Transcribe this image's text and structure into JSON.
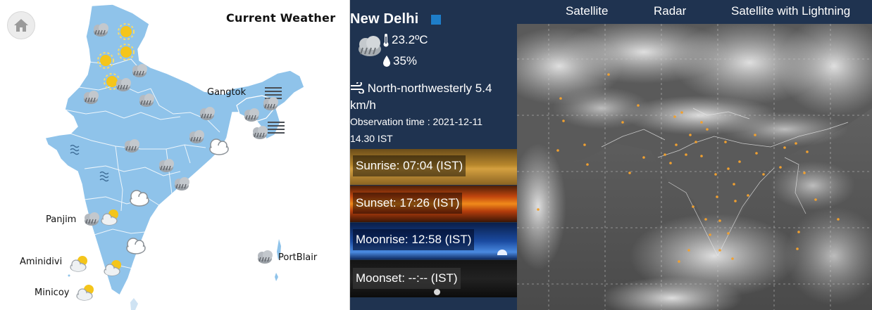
{
  "map": {
    "title": "Current Weather",
    "home_icon": "home-icon",
    "land_color": "#8fc3ea",
    "cities": {
      "gangtok": "Gangtok",
      "panjim": "Panjim",
      "aminidivi": "Aminidivi",
      "minicoy": "Minicoy",
      "portblair": "PortBlair"
    }
  },
  "city": {
    "name": "New Delhi",
    "condition_icon": "cloudy-icon",
    "temperature": "23.2ºC",
    "humidity": "35%",
    "wind": "North-northwesterly 5.4 km/h",
    "observation_line1": "Observation time : 2021-12-11",
    "observation_line2": "14.30 IST",
    "sunrise": "Sunrise: 07:04 (IST)",
    "sunset": "Sunset: 17:26 (IST)",
    "moonrise": "Moonrise: 12:58 (IST)",
    "moonset": "Moonset: --:-- (IST)"
  },
  "satellite": {
    "tabs": [
      "Satellite",
      "Radar",
      "Satellite with Lightning"
    ]
  },
  "colors": {
    "panel_bg": "#1f3350",
    "accent": "#1e7ec9",
    "sat_label": "#f0a030"
  }
}
